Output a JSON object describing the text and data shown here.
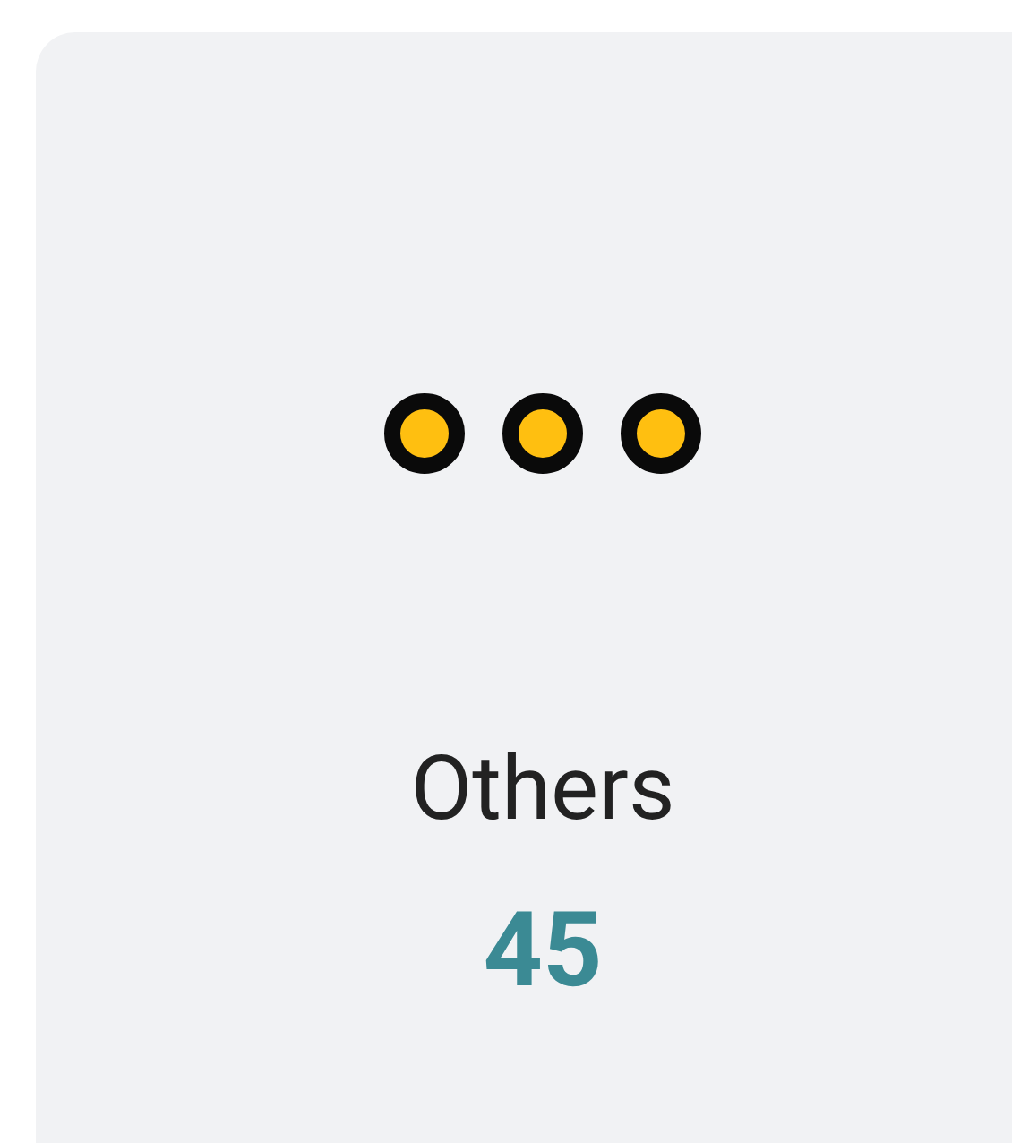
{
  "category": {
    "label": "Others",
    "count": "45"
  }
}
